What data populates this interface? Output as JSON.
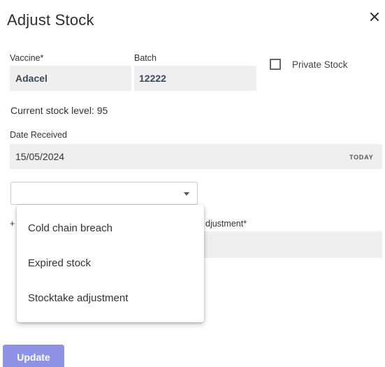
{
  "dialog": {
    "title": "Adjust Stock",
    "close_icon": "close-icon"
  },
  "vaccine": {
    "label": "Vaccine",
    "required_mark": "*",
    "value": "Adacel"
  },
  "batch": {
    "label": "Batch",
    "value": "12222"
  },
  "private_stock": {
    "label": "Private Stock",
    "checked": false
  },
  "stock_level": {
    "text": "Current stock level: 95"
  },
  "date_received": {
    "label": "Date Received",
    "value": "15/05/2024",
    "today_label": "TODAY"
  },
  "reason_select": {
    "value": "",
    "options": [
      "Cold chain breach",
      "Expired stock",
      "Stocktake adjustment"
    ]
  },
  "adjustment": {
    "label_prefix": "+",
    "label": "djustment",
    "required_mark": "*"
  },
  "actions": {
    "update_label": "Update"
  },
  "colors": {
    "primary_button": "#8e93e6",
    "field_background": "#efefef"
  }
}
